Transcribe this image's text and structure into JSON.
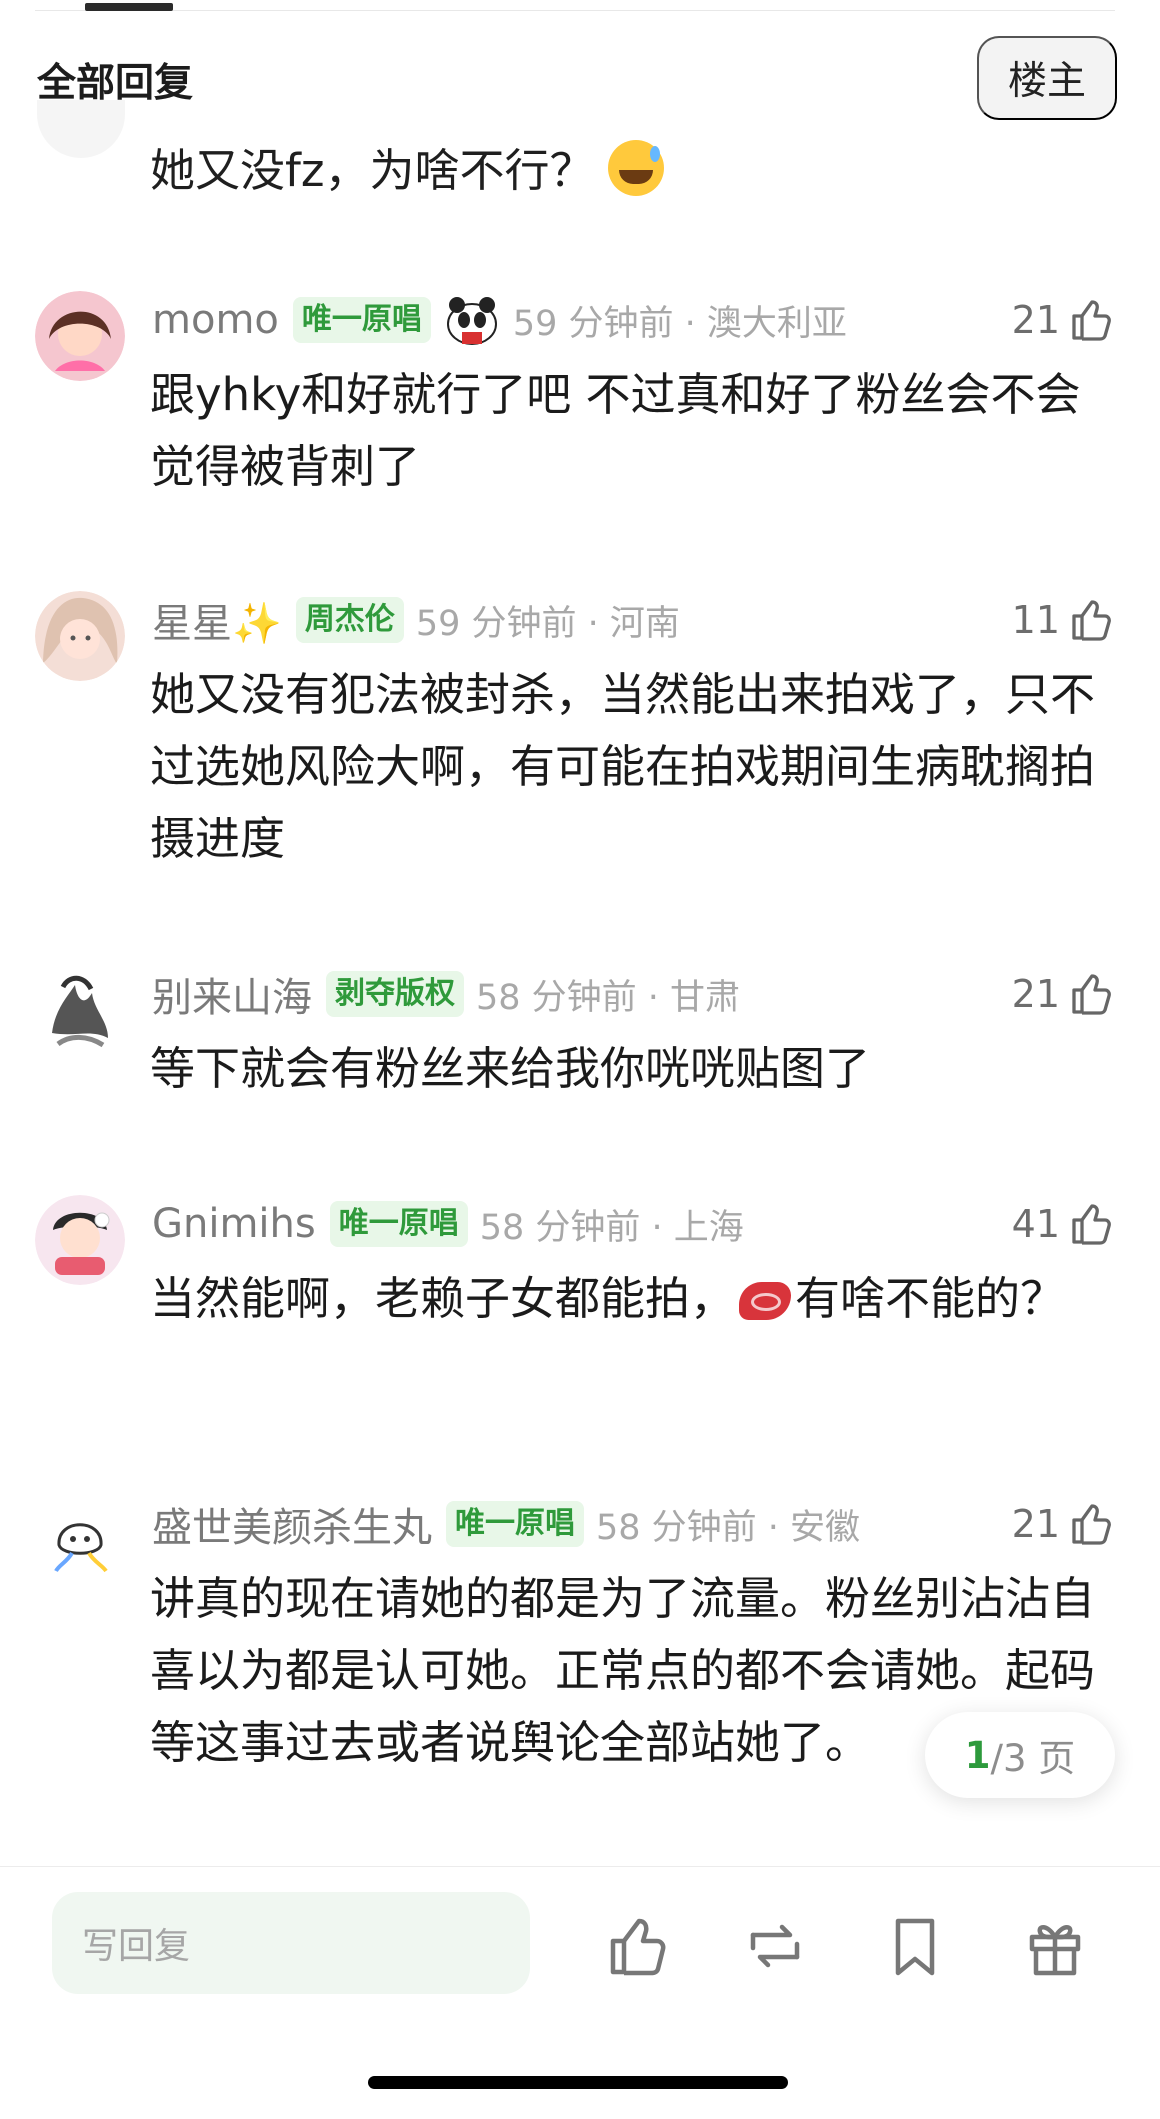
{
  "header": {
    "title": "全部回复",
    "op_label": "楼主"
  },
  "partial_comment": {
    "text": "她又没fz，为啥不行？"
  },
  "comments": [
    {
      "username": "momo",
      "badge": "唯一原唱",
      "time_location": "59 分钟前 · 澳大利亚",
      "likes": "21",
      "text": "跟yhky和好就行了吧 不过真和好了粉丝会不会觉得被背刺了"
    },
    {
      "username": "星星✨",
      "badge": "周杰伦",
      "time_location": "59 分钟前 · 河南",
      "likes": "11",
      "text": "她又没有犯法被封杀，当然能出来拍戏了，只不过选她风险大啊，有可能在拍戏期间生病耽搁拍摄进度"
    },
    {
      "username": "别来山海",
      "badge": "剥夺版权",
      "time_location": "58 分钟前 · 甘肃",
      "likes": "21",
      "text": "等下就会有粉丝来给我你咣咣贴图了"
    },
    {
      "username": "Gnimihs",
      "badge": "唯一原唱",
      "time_location": "58 分钟前 · 上海",
      "likes": "41",
      "text_before": "当然能啊，老赖子女都能拍，",
      "text_after": "有啥不能的？"
    },
    {
      "username": "盛世美颜杀生丸",
      "badge": "唯一原唱",
      "time_location": "58 分钟前 · 安徽",
      "likes": "21",
      "text": "讲真的现在请她的都是为了流量。粉丝别沾沾自喜以为都是认可她。正常点的都不会请她。起码等这事过去或者说舆论全部站她了。"
    }
  ],
  "pager": {
    "current": "1",
    "total": "/3 页"
  },
  "bottom_bar": {
    "reply_placeholder": "写回复"
  },
  "icons": {
    "like": "thumbs-up-icon",
    "repost": "repost-icon",
    "favorite": "bookmark-icon",
    "gift": "gift-icon"
  },
  "colors": {
    "badge_text": "#2f9a3b",
    "badge_bg": "#e8f7e8",
    "pager_current": "#2d9a3c"
  }
}
